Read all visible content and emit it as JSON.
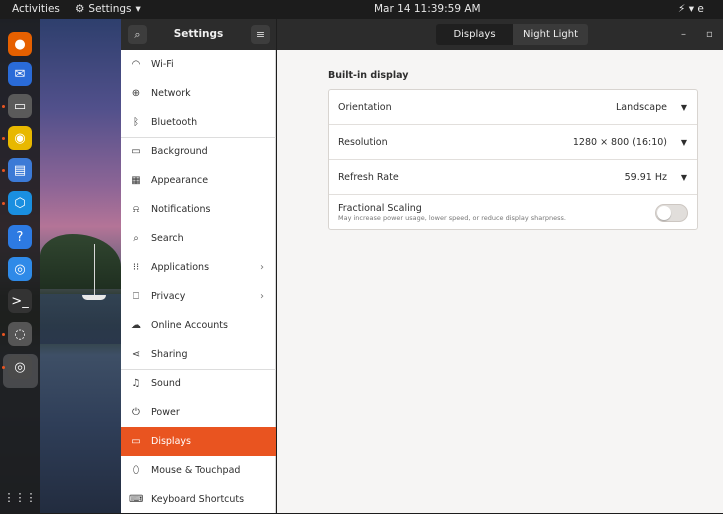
{
  "topbar": {
    "activities": "Activities",
    "app_menu": "Settings",
    "app_menu_caret": "▾",
    "clock": "Mar 14  11:39:59 AM",
    "tray": "⚡ ▾  e"
  },
  "dock": {
    "items": [
      {
        "name": "firefox-icon",
        "color": "#e66000",
        "glyph": "●"
      },
      {
        "name": "thunderbird-icon",
        "color": "#2a6bd8",
        "glyph": "✉"
      },
      {
        "name": "files-icon",
        "color": "#5a5a5a",
        "glyph": "▭"
      },
      {
        "name": "rhythmbox-icon",
        "color": "#e8b800",
        "glyph": "◉"
      },
      {
        "name": "writer-icon",
        "color": "#3c7ad6",
        "glyph": "▤"
      },
      {
        "name": "software-icon",
        "color": "#1a8fe0",
        "glyph": "⬡"
      },
      {
        "name": "help-icon",
        "color": "#2d7ae2",
        "glyph": "?"
      },
      {
        "name": "chromium-icon",
        "color": "#2f8ae8",
        "glyph": "◎"
      },
      {
        "name": "terminal-icon",
        "color": "#333333",
        "glyph": ">_"
      },
      {
        "name": "chat-icon",
        "color": "#555555",
        "glyph": "◌"
      },
      {
        "name": "settings-dock-icon",
        "color": "#4a4a4a",
        "glyph": "◎"
      }
    ],
    "apps_grid": "⋮⋮⋮"
  },
  "header": {
    "title": "Settings",
    "search_glyph": "⌕",
    "menu_glyph": "≡",
    "tabs": [
      {
        "label": "Displays"
      },
      {
        "label": "Night Light"
      }
    ],
    "minimize": "–",
    "maximize": "▫"
  },
  "sidebar": {
    "items": [
      {
        "label": "Wi-Fi",
        "icon": "◠"
      },
      {
        "label": "Network",
        "icon": "⊕"
      },
      {
        "label": "Bluetooth",
        "icon": "ᛒ"
      },
      {
        "label": "Background",
        "icon": "▭"
      },
      {
        "label": "Appearance",
        "icon": "▦"
      },
      {
        "label": "Notifications",
        "icon": "⍾"
      },
      {
        "label": "Search",
        "icon": "⌕"
      },
      {
        "label": "Applications",
        "icon": "⁝⁝",
        "chevron": "›"
      },
      {
        "label": "Privacy",
        "icon": "⎕",
        "chevron": "›"
      },
      {
        "label": "Online Accounts",
        "icon": "☁"
      },
      {
        "label": "Sharing",
        "icon": "⋖"
      },
      {
        "label": "Sound",
        "icon": "♫"
      },
      {
        "label": "Power",
        "icon": "⏻"
      },
      {
        "label": "Displays",
        "icon": "▭",
        "selected": true
      },
      {
        "label": "Mouse & Touchpad",
        "icon": "⬯"
      },
      {
        "label": "Keyboard Shortcuts",
        "icon": "⌨"
      }
    ]
  },
  "main": {
    "section_title": "Built-in display",
    "rows": {
      "orientation": {
        "label": "Orientation",
        "value": "Landscape",
        "caret": "▼"
      },
      "resolution": {
        "label": "Resolution",
        "value": "1280 × 800 (16:10)",
        "caret": "▼"
      },
      "refresh": {
        "label": "Refresh Rate",
        "value": "59.91 Hz",
        "caret": "▼"
      },
      "scaling": {
        "label": "Fractional Scaling",
        "sub": "May increase power usage, lower speed, or reduce display sharpness.",
        "enabled": false
      }
    }
  },
  "colors": {
    "accent": "#e95420",
    "header_bg": "#2c2c2c",
    "sidebar_bg": "#ffffff",
    "main_bg": "#f6f5f4"
  }
}
